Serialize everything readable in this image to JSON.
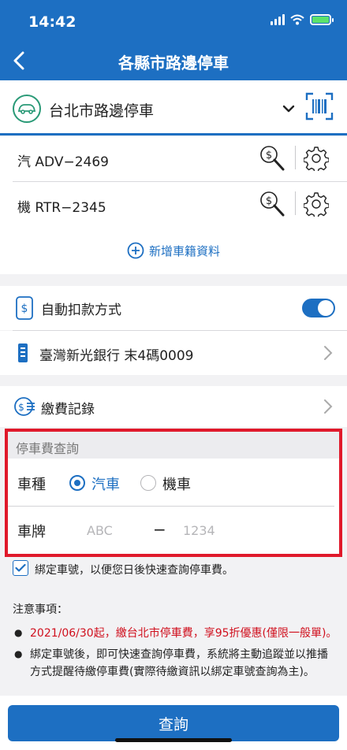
{
  "status_bar": {
    "time": "14:42"
  },
  "header": {
    "title": "各縣市路邊停車"
  },
  "city": {
    "label": "台北市路邊停車"
  },
  "vehicles": [
    {
      "label": "汽 ADV−2469"
    },
    {
      "label": "機 RTR−2345"
    }
  ],
  "add_vehicle": {
    "label": "新增車籍資料"
  },
  "auto_payment": {
    "label": "自動扣款方式",
    "enabled": true
  },
  "bank": {
    "label": "臺灣新光銀行 末4碼0009"
  },
  "records": {
    "label": "繳費記錄"
  },
  "query": {
    "title": "停車費查詢",
    "type_label": "車種",
    "option_car": "汽車",
    "option_moto": "機車",
    "selected": "汽車",
    "plate_label": "車牌",
    "plate_a_placeholder": "ABC",
    "plate_dash": "−",
    "plate_b_placeholder": "1234"
  },
  "bind": {
    "label": "綁定車號，以便您日後快速查詢停車費。",
    "checked": true
  },
  "notes": {
    "title": "注意事項：",
    "items": [
      "2021/06/30起，繳台北市停車費，享95折優惠(僅限一般單)。",
      "綁定車號後，即可快速查詢停車費，系統將主動追蹤並以推播方式提醒待繳停車費(實際待繳資訊以綁定車號查詢為主)。"
    ]
  },
  "submit": {
    "label": "查詢"
  },
  "colors": {
    "primary": "#1d6fc2",
    "highlight": "#e0192b",
    "notice": "#d0101e",
    "accent_green": "#2a9a77"
  }
}
